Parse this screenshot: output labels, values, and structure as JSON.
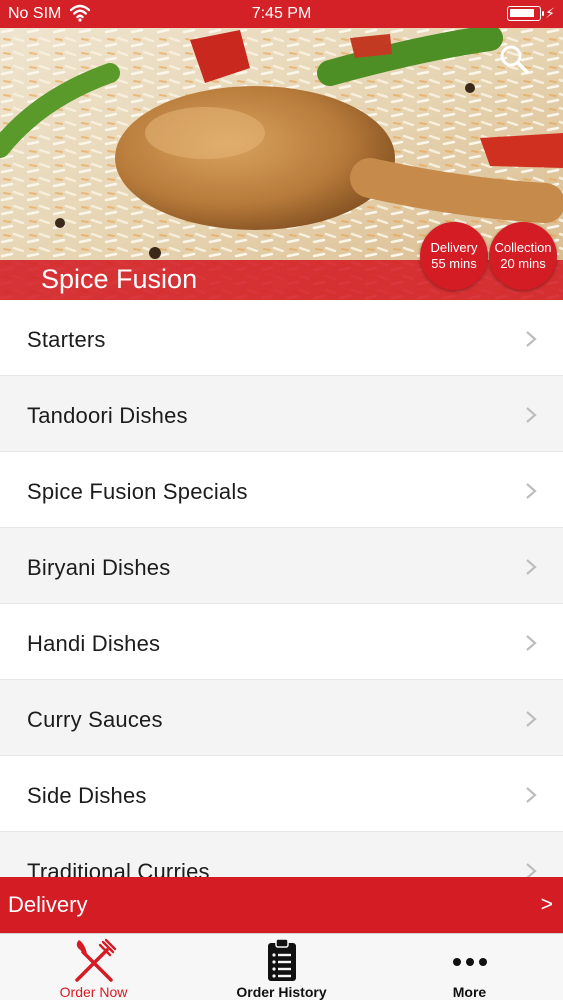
{
  "status_bar": {
    "carrier": "No SIM",
    "time": "7:45 PM",
    "battery_level": 0.9
  },
  "restaurant": {
    "name": "Spice Fusion",
    "delivery": {
      "label": "Delivery",
      "time": "55 mins"
    },
    "collection": {
      "label": "Collection",
      "time": "20 mins"
    }
  },
  "menu": {
    "categories": [
      {
        "label": "Starters"
      },
      {
        "label": "Tandoori Dishes"
      },
      {
        "label": "Spice Fusion Specials"
      },
      {
        "label": "Biryani Dishes"
      },
      {
        "label": "Handi Dishes"
      },
      {
        "label": "Curry Sauces"
      },
      {
        "label": "Side Dishes"
      },
      {
        "label": "Traditional Curries"
      }
    ]
  },
  "order_mode": {
    "label": "Delivery",
    "arrow": ">"
  },
  "tabs": [
    {
      "label": "Order Now",
      "icon": "fork-knife-icon"
    },
    {
      "label": "Order History",
      "icon": "clipboard-list-icon"
    },
    {
      "label": "More",
      "icon": "more-dots-icon"
    }
  ],
  "colors": {
    "brand_red": "#d41c25",
    "alt_row": "#f4f4f4"
  }
}
